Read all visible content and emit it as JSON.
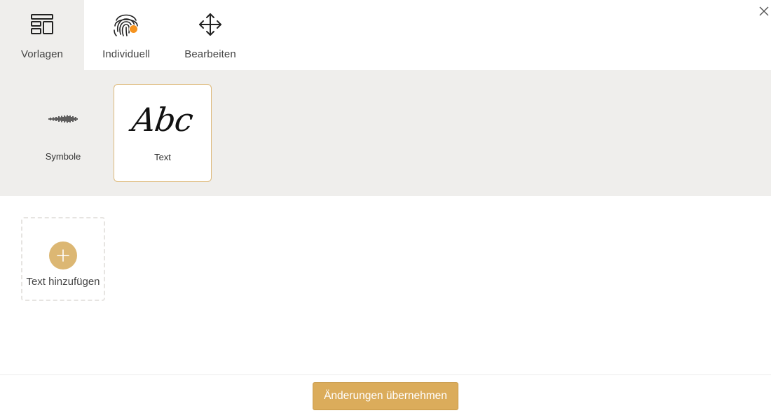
{
  "tabs": [
    {
      "label": "Vorlagen",
      "icon": "layout-template-icon",
      "active": true
    },
    {
      "label": "Individuell",
      "icon": "fingerprint-icon",
      "active": false
    },
    {
      "label": "Bearbeiten",
      "icon": "move-arrows-icon",
      "active": false
    }
  ],
  "categories": [
    {
      "label": "Symbole",
      "icon": "soundwave-icon",
      "selected": false
    },
    {
      "label": "Text",
      "preview": "Abc",
      "selected": true
    }
  ],
  "add_tile": {
    "label": "Text hinzufügen",
    "icon": "plus-icon"
  },
  "footer": {
    "apply_label": "Änderungen übernehmen"
  },
  "colors": {
    "accent": "#dbac5b",
    "panel": "#efeeec",
    "selected_border": "#ddb97a",
    "badge": "#f5931f"
  },
  "close_icon": "close-icon"
}
